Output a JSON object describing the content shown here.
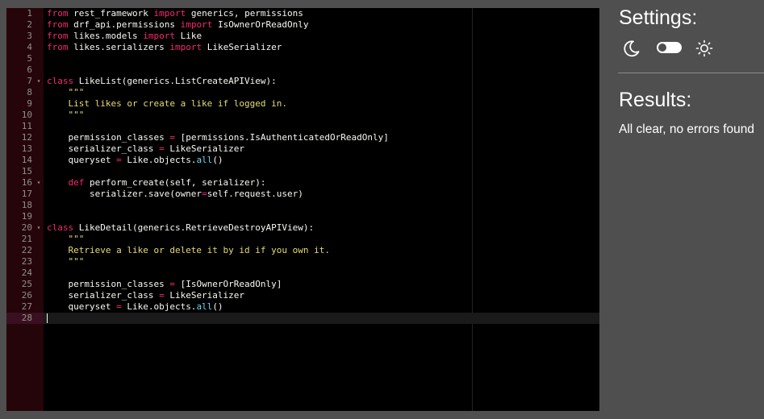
{
  "editor": {
    "lines": [
      {
        "n": "1",
        "tokens": [
          {
            "t": "kw",
            "v": "from"
          },
          {
            "t": "",
            "v": " rest_framework "
          },
          {
            "t": "kw",
            "v": "import"
          },
          {
            "t": "",
            "v": " generics, permissions"
          }
        ]
      },
      {
        "n": "2",
        "tokens": [
          {
            "t": "kw",
            "v": "from"
          },
          {
            "t": "",
            "v": " drf_api.permissions "
          },
          {
            "t": "kw",
            "v": "import"
          },
          {
            "t": "",
            "v": " IsOwnerOrReadOnly"
          }
        ]
      },
      {
        "n": "3",
        "tokens": [
          {
            "t": "kw",
            "v": "from"
          },
          {
            "t": "",
            "v": " likes.models "
          },
          {
            "t": "kw",
            "v": "import"
          },
          {
            "t": "",
            "v": " Like"
          }
        ]
      },
      {
        "n": "4",
        "tokens": [
          {
            "t": "kw",
            "v": "from"
          },
          {
            "t": "",
            "v": " likes.serializers "
          },
          {
            "t": "kw",
            "v": "import"
          },
          {
            "t": "",
            "v": " LikeSerializer"
          }
        ]
      },
      {
        "n": "5",
        "tokens": []
      },
      {
        "n": "6",
        "tokens": []
      },
      {
        "n": "7",
        "fold": true,
        "tokens": [
          {
            "t": "kw",
            "v": "class"
          },
          {
            "t": "",
            "v": " LikeList(generics.ListCreateAPIView):"
          }
        ]
      },
      {
        "n": "8",
        "tokens": [
          {
            "t": "str",
            "v": "    \"\"\""
          }
        ]
      },
      {
        "n": "9",
        "tokens": [
          {
            "t": "str",
            "v": "    List likes or create a like if logged in."
          }
        ]
      },
      {
        "n": "10",
        "tokens": [
          {
            "t": "str",
            "v": "    \"\"\""
          }
        ]
      },
      {
        "n": "11",
        "tokens": []
      },
      {
        "n": "12",
        "tokens": [
          {
            "t": "",
            "v": "    permission_classes "
          },
          {
            "t": "kw",
            "v": "="
          },
          {
            "t": "",
            "v": " [permissions.IsAuthenticatedOrReadOnly]"
          }
        ]
      },
      {
        "n": "13",
        "tokens": [
          {
            "t": "",
            "v": "    serializer_class "
          },
          {
            "t": "kw",
            "v": "="
          },
          {
            "t": "",
            "v": " LikeSerializer"
          }
        ]
      },
      {
        "n": "14",
        "tokens": [
          {
            "t": "",
            "v": "    queryset "
          },
          {
            "t": "kw",
            "v": "="
          },
          {
            "t": "",
            "v": " Like.objects."
          },
          {
            "t": "bi",
            "v": "all"
          },
          {
            "t": "",
            "v": "()"
          }
        ]
      },
      {
        "n": "15",
        "tokens": []
      },
      {
        "n": "16",
        "fold": true,
        "tokens": [
          {
            "t": "",
            "v": "    "
          },
          {
            "t": "kw",
            "v": "def"
          },
          {
            "t": "",
            "v": " perform_create(self, serializer):"
          }
        ]
      },
      {
        "n": "17",
        "tokens": [
          {
            "t": "",
            "v": "        serializer.save(owner"
          },
          {
            "t": "kw",
            "v": "="
          },
          {
            "t": "",
            "v": "self.request.user)"
          }
        ]
      },
      {
        "n": "18",
        "tokens": []
      },
      {
        "n": "19",
        "tokens": []
      },
      {
        "n": "20",
        "fold": true,
        "tokens": [
          {
            "t": "kw",
            "v": "class"
          },
          {
            "t": "",
            "v": " LikeDetail(generics.RetrieveDestroyAPIView):"
          }
        ]
      },
      {
        "n": "21",
        "tokens": [
          {
            "t": "str",
            "v": "    \"\"\""
          }
        ]
      },
      {
        "n": "22",
        "tokens": [
          {
            "t": "str",
            "v": "    Retrieve a like or delete it by id if you own it."
          }
        ]
      },
      {
        "n": "23",
        "tokens": [
          {
            "t": "str",
            "v": "    \"\"\""
          }
        ]
      },
      {
        "n": "24",
        "tokens": []
      },
      {
        "n": "25",
        "tokens": [
          {
            "t": "",
            "v": "    permission_classes "
          },
          {
            "t": "kw",
            "v": "="
          },
          {
            "t": "",
            "v": " [IsOwnerOrReadOnly]"
          }
        ]
      },
      {
        "n": "26",
        "tokens": [
          {
            "t": "",
            "v": "    serializer_class "
          },
          {
            "t": "kw",
            "v": "="
          },
          {
            "t": "",
            "v": " LikeSerializer"
          }
        ]
      },
      {
        "n": "27",
        "tokens": [
          {
            "t": "",
            "v": "    queryset "
          },
          {
            "t": "kw",
            "v": "="
          },
          {
            "t": "",
            "v": " Like.objects."
          },
          {
            "t": "bi",
            "v": "all"
          },
          {
            "t": "",
            "v": "()"
          }
        ]
      },
      {
        "n": "28",
        "active": true,
        "tokens": []
      }
    ]
  },
  "settings": {
    "title": "Settings:",
    "dark_icon": "moon-icon",
    "light_icon": "sun-icon",
    "theme_toggle_on": false
  },
  "results": {
    "title": "Results:",
    "message": "All clear, no errors found"
  },
  "colors": {
    "background": "#4f4f4f",
    "editor_bg": "#000000",
    "gutter_bg": "#25050a",
    "keyword": "#f92672",
    "string": "#e6db74",
    "builtin": "#66d9ef"
  }
}
